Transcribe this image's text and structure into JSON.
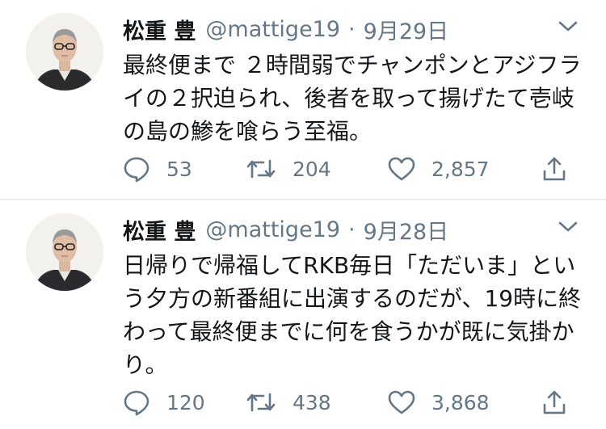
{
  "tweets": [
    {
      "name": "松重 豊",
      "handle": "@mattige19",
      "dot": "·",
      "date": "9月29日",
      "text": "最終便まで ２時間弱でチャンポンとアジフライの２択迫られ、後者を取って揚げたて壱岐の島の鯵を喰らう至福。",
      "replies": "53",
      "retweets": "204",
      "likes": "2,857"
    },
    {
      "name": "松重 豊",
      "handle": "@mattige19",
      "dot": "·",
      "date": "9月28日",
      "text": "日帰りで帰福してRKB毎日「ただいま」という夕方の新番組に出演するのだが、19時に終わって最終便までに何を食うかが既に気掛かり。",
      "replies": "120",
      "retweets": "438",
      "likes": "3,868"
    }
  ],
  "colors": {
    "text": "#14171a",
    "secondary": "#657786",
    "divider": "#e6ecf0"
  },
  "icons": [
    "reply-icon",
    "retweet-icon",
    "like-icon",
    "share-icon",
    "chevron-down-icon"
  ]
}
